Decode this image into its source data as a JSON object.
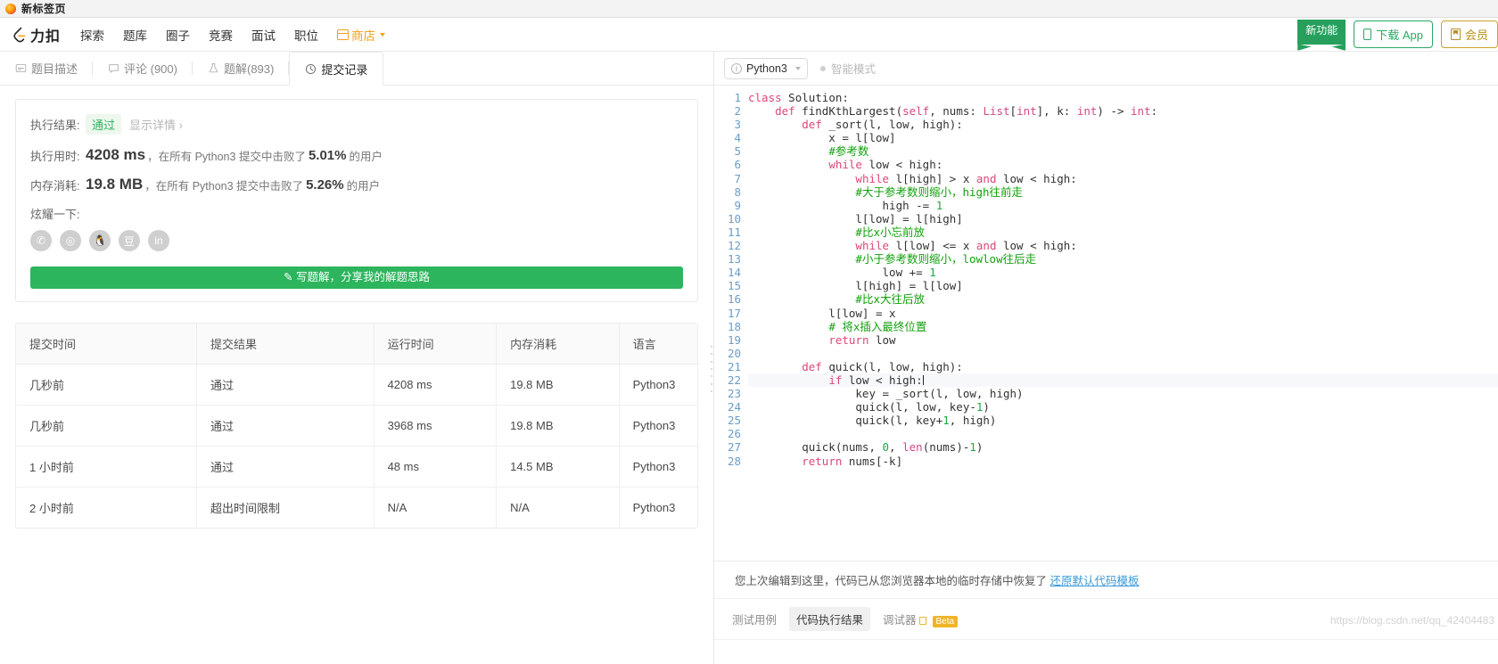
{
  "browser": {
    "tab_title": "新标签页",
    "favicon": "firefox-icon"
  },
  "header": {
    "brand": "力扣",
    "nav": [
      {
        "label": "探索"
      },
      {
        "label": "题库"
      },
      {
        "label": "圈子"
      },
      {
        "label": "竞赛"
      },
      {
        "label": "面试"
      },
      {
        "label": "职位"
      }
    ],
    "shop": {
      "label": "商店",
      "icon": "shop-icon"
    },
    "ribbon": "新功能",
    "download_app": "下载 App",
    "member": "会员"
  },
  "tabs": [
    {
      "label": "题目描述",
      "icon": "description-icon",
      "active": false
    },
    {
      "label": "评论 (900)",
      "icon": "comment-icon",
      "active": false
    },
    {
      "label": "题解(893)",
      "icon": "solution-icon",
      "active": false
    },
    {
      "label": "提交记录",
      "icon": "clock-icon",
      "active": true
    }
  ],
  "result": {
    "result_label": "执行结果:",
    "result_status": "通过",
    "detail_link": "显示详情 ›",
    "runtime_label": "执行用时:",
    "runtime_value": "4208 ms",
    "runtime_note_pre": "，在所有 Python3 提交中击败了",
    "runtime_percent": "5.01%",
    "runtime_note_post": "的用户",
    "memory_label": "内存消耗:",
    "memory_value": "19.8 MB",
    "memory_note_pre": "，在所有 Python3 提交中击败了",
    "memory_percent": "5.26%",
    "memory_note_post": "的用户",
    "share_label": "炫耀一下:",
    "share_icons": [
      {
        "name": "wechat-share-icon",
        "glyph": "✆"
      },
      {
        "name": "weibo-share-icon",
        "glyph": "◎"
      },
      {
        "name": "qq-share-icon",
        "glyph": "🐧"
      },
      {
        "name": "douban-share-icon",
        "glyph": "豆"
      },
      {
        "name": "linkedin-share-icon",
        "glyph": "in"
      }
    ],
    "write_solution_button": "✎ 写题解，分享我的解题思路"
  },
  "submissions": {
    "columns": [
      "提交时间",
      "提交结果",
      "运行时间",
      "内存消耗",
      "语言"
    ],
    "rows": [
      {
        "time": "几秒前",
        "status": "通过",
        "status_type": "pass",
        "runtime": "4208 ms",
        "memory": "19.8 MB",
        "language": "Python3"
      },
      {
        "time": "几秒前",
        "status": "通过",
        "status_type": "pass",
        "runtime": "3968 ms",
        "memory": "19.8 MB",
        "language": "Python3"
      },
      {
        "time": "1 小时前",
        "status": "通过",
        "status_type": "pass",
        "runtime": "48 ms",
        "memory": "14.5 MB",
        "language": "Python3"
      },
      {
        "time": "2 小时前",
        "status": "超出时间限制",
        "status_type": "fail",
        "runtime": "N/A",
        "memory": "N/A",
        "language": "Python3"
      }
    ]
  },
  "editor": {
    "language": "Python3",
    "smart_mode": "智能模式",
    "code_lines": [
      "class Solution:",
      "    def findKthLargest(self, nums: List[int], k: int) -> int:",
      "        def _sort(l, low, high):",
      "            x = l[low]",
      "            #参考数",
      "            while low < high:",
      "                while l[high] > x and low < high:",
      "                #大于参考数则缩小，high往前走",
      "                    high -= 1",
      "                l[low] = l[high]",
      "                #比x小忘前放",
      "                while l[low] <= x and low < high:",
      "                #小于参考数则缩小，lowlow往后走",
      "                    low += 1",
      "                l[high] = l[low]",
      "                #比x大往后放",
      "            l[low] = x",
      "            # 将x插入最终位置",
      "            return low",
      "",
      "        def quick(l, low, high):",
      "            if low < high:",
      "                key = _sort(l, low, high)",
      "                quick(l, low, key-1)",
      "                quick(l, key+1, high)",
      "",
      "        quick(nums, 0, len(nums)-1)",
      "        return nums[-k]"
    ],
    "highlighted_line": 22,
    "total_lines": 28
  },
  "bottom": {
    "restore_text": "您上次编辑到这里，代码已从您浏览器本地的临时存储中恢复了",
    "restore_link": "还原默认代码模板",
    "console_tabs": [
      {
        "label": "测试用例",
        "active": false
      },
      {
        "label": "代码执行结果",
        "active": true
      },
      {
        "label": "调试器",
        "active": false,
        "badge": "Beta",
        "icon": "lock-icon"
      }
    ]
  },
  "watermark": "https://blog.csdn.net/qq_42404483",
  "colors": {
    "brand_orange": "#f3a01b",
    "pass_green": "#5cb85c",
    "fail_red": "#ef4743",
    "accent_green": "#2db55d",
    "link_blue": "#3a9ad9"
  }
}
